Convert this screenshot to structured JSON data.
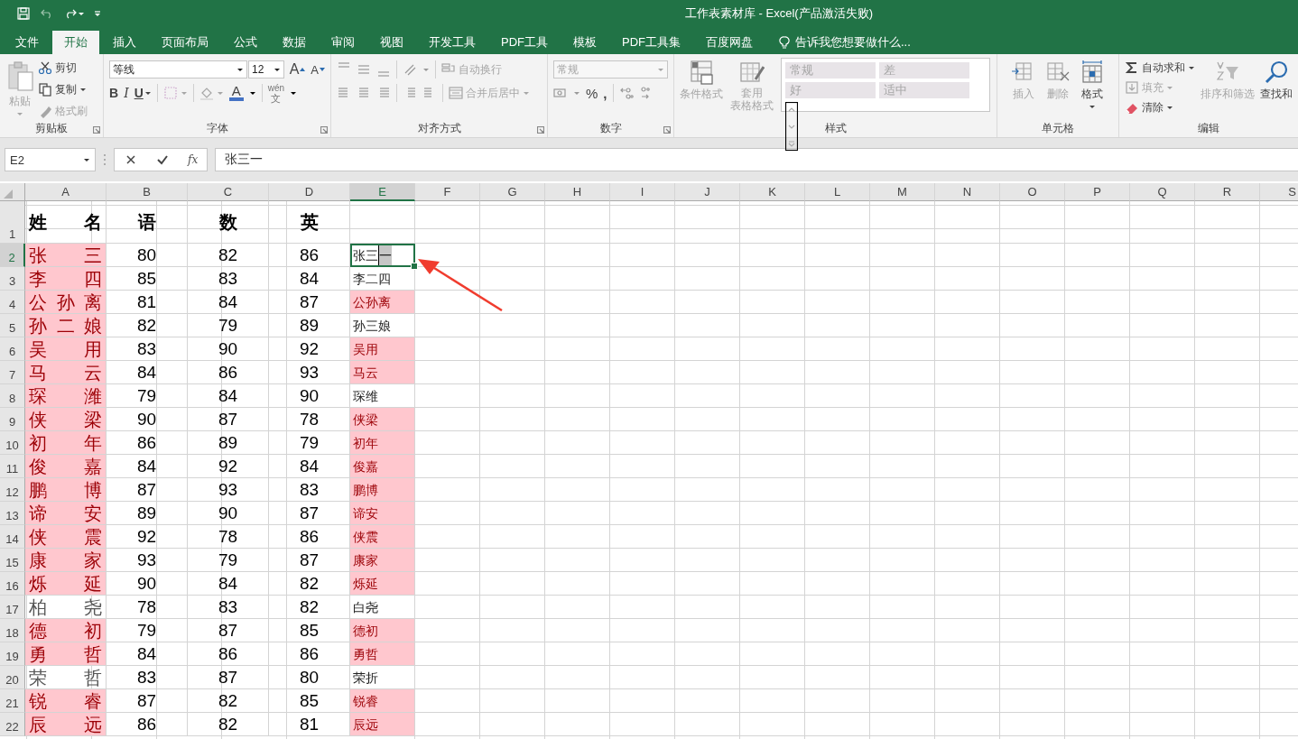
{
  "window": {
    "title": "工作表素材库 - Excel(产品激活失败)"
  },
  "tabs": [
    {
      "label": "文件",
      "selected": false
    },
    {
      "label": "开始",
      "selected": true
    },
    {
      "label": "插入",
      "selected": false
    },
    {
      "label": "页面布局",
      "selected": false
    },
    {
      "label": "公式",
      "selected": false
    },
    {
      "label": "数据",
      "selected": false
    },
    {
      "label": "审阅",
      "selected": false
    },
    {
      "label": "视图",
      "selected": false
    },
    {
      "label": "开发工具",
      "selected": false
    },
    {
      "label": "PDF工具",
      "selected": false
    },
    {
      "label": "模板",
      "selected": false
    },
    {
      "label": "PDF工具集",
      "selected": false
    },
    {
      "label": "百度网盘",
      "selected": false
    }
  ],
  "tell_me": {
    "placeholder": "告诉我您想要做什么..."
  },
  "ribbon": {
    "clipboard": {
      "label": "剪贴板",
      "paste": {
        "label": "粘贴",
        "disabled": true
      },
      "cut": {
        "label": "剪切",
        "disabled": false
      },
      "copy": {
        "label": "复制",
        "disabled": false
      },
      "format_painter": {
        "label": "格式刷",
        "disabled": true
      }
    },
    "font": {
      "label": "字体",
      "font_name": "等线",
      "font_size": "12",
      "grow": "A",
      "shrink": "A",
      "styles": [
        "B",
        "I",
        "U"
      ],
      "font_color": "A",
      "phonetic": [
        "wén",
        "文"
      ]
    },
    "alignment": {
      "label": "对齐方式",
      "wrap_text": {
        "label": "自动换行",
        "disabled": true
      },
      "merge": {
        "label": "合并后居中",
        "disabled": true
      }
    },
    "number": {
      "label": "数字",
      "format": "常规",
      "percent": "%",
      "comma": ","
    },
    "styles": {
      "label": "样式",
      "conditional": {
        "label": "条件格式",
        "disabled": true
      },
      "table_format": {
        "lines": [
          "套用",
          "表格格式"
        ],
        "disabled": true
      },
      "gallery": [
        "常规",
        "差",
        "好",
        "适中"
      ]
    },
    "cells": {
      "label": "单元格",
      "insert": {
        "label": "插入",
        "disabled": true
      },
      "delete": {
        "label": "删除",
        "disabled": true
      },
      "format": {
        "label": "格式",
        "disabled": false
      }
    },
    "editing": {
      "label": "编辑",
      "autosum": {
        "label": "自动求和",
        "disabled": false
      },
      "fill": {
        "label": "填充",
        "disabled": true
      },
      "clear": {
        "label": "清除",
        "disabled": false
      },
      "sort": {
        "label": "排序和筛选",
        "disabled": true
      },
      "find": {
        "label": "查找和",
        "disabled": false
      }
    }
  },
  "formula_bar": {
    "name_box": "E2",
    "function_label": "fx",
    "value": "张三一"
  },
  "sheet": {
    "columns": [
      {
        "label": "A",
        "selected": false
      },
      {
        "label": "B",
        "selected": false
      },
      {
        "label": "C",
        "selected": false
      },
      {
        "label": "D",
        "selected": false
      },
      {
        "label": "E",
        "selected": true
      },
      {
        "label": "F",
        "selected": false
      },
      {
        "label": "G",
        "selected": false
      },
      {
        "label": "H",
        "selected": false
      },
      {
        "label": "I",
        "selected": false
      },
      {
        "label": "J",
        "selected": false
      },
      {
        "label": "K",
        "selected": false
      },
      {
        "label": "L",
        "selected": false
      },
      {
        "label": "M",
        "selected": false
      },
      {
        "label": "N",
        "selected": false
      },
      {
        "label": "O",
        "selected": false
      },
      {
        "label": "P",
        "selected": false
      },
      {
        "label": "Q",
        "selected": false
      },
      {
        "label": "R",
        "selected": false
      },
      {
        "label": "S",
        "selected": false
      }
    ],
    "rows": [
      {
        "kind": "header",
        "number": "1",
        "selected": false,
        "name": "姓名",
        "highlighted": false,
        "scores": [
          "语",
          "数",
          "英"
        ]
      },
      {
        "kind": "data",
        "number": "2",
        "selected": true,
        "name": "张三",
        "highlighted": true,
        "scores": [
          "80",
          "82",
          "86"
        ],
        "e": {
          "text": "张三",
          "selection": "一",
          "highlighted": false,
          "editing": true
        }
      },
      {
        "kind": "data",
        "number": "3",
        "selected": false,
        "name": "李四",
        "highlighted": true,
        "scores": [
          "85",
          "83",
          "84"
        ],
        "e": {
          "text": "李二四",
          "highlighted": false,
          "editing": false
        }
      },
      {
        "kind": "data",
        "number": "4",
        "selected": false,
        "name": "公孙离",
        "highlighted": true,
        "scores": [
          "81",
          "84",
          "87"
        ],
        "e": {
          "text": "公孙离",
          "highlighted": true,
          "editing": false
        }
      },
      {
        "kind": "data",
        "number": "5",
        "selected": false,
        "name": "孙二娘",
        "highlighted": true,
        "scores": [
          "82",
          "79",
          "89"
        ],
        "e": {
          "text": "孙三娘",
          "highlighted": false,
          "editing": false
        }
      },
      {
        "kind": "data",
        "number": "6",
        "selected": false,
        "name": "吴用",
        "highlighted": true,
        "scores": [
          "83",
          "90",
          "92"
        ],
        "e": {
          "text": "吴用",
          "highlighted": true,
          "editing": false
        }
      },
      {
        "kind": "data",
        "number": "7",
        "selected": false,
        "name": "马云",
        "highlighted": true,
        "scores": [
          "84",
          "86",
          "93"
        ],
        "e": {
          "text": "马云",
          "highlighted": true,
          "editing": false
        }
      },
      {
        "kind": "data",
        "number": "8",
        "selected": false,
        "name": "琛潍",
        "highlighted": true,
        "scores": [
          "79",
          "84",
          "90"
        ],
        "e": {
          "text": "琛维",
          "highlighted": false,
          "editing": false
        }
      },
      {
        "kind": "data",
        "number": "9",
        "selected": false,
        "name": "侠梁",
        "highlighted": true,
        "scores": [
          "90",
          "87",
          "78"
        ],
        "e": {
          "text": "侠梁",
          "highlighted": true,
          "editing": false
        }
      },
      {
        "kind": "data",
        "number": "10",
        "selected": false,
        "name": "初年",
        "highlighted": true,
        "scores": [
          "86",
          "89",
          "79"
        ],
        "e": {
          "text": "初年",
          "highlighted": true,
          "editing": false
        }
      },
      {
        "kind": "data",
        "number": "11",
        "selected": false,
        "name": "俊嘉",
        "highlighted": true,
        "scores": [
          "84",
          "92",
          "84"
        ],
        "e": {
          "text": "俊嘉",
          "highlighted": true,
          "editing": false
        }
      },
      {
        "kind": "data",
        "number": "12",
        "selected": false,
        "name": "鹏博",
        "highlighted": true,
        "scores": [
          "87",
          "93",
          "83"
        ],
        "e": {
          "text": "鹏博",
          "highlighted": true,
          "editing": false
        }
      },
      {
        "kind": "data",
        "number": "13",
        "selected": false,
        "name": "谛安",
        "highlighted": true,
        "scores": [
          "89",
          "90",
          "87"
        ],
        "e": {
          "text": "谛安",
          "highlighted": true,
          "editing": false
        }
      },
      {
        "kind": "data",
        "number": "14",
        "selected": false,
        "name": "侠震",
        "highlighted": true,
        "scores": [
          "92",
          "78",
          "86"
        ],
        "e": {
          "text": "侠震",
          "highlighted": true,
          "editing": false
        }
      },
      {
        "kind": "data",
        "number": "15",
        "selected": false,
        "name": "康家",
        "highlighted": true,
        "scores": [
          "93",
          "79",
          "87"
        ],
        "e": {
          "text": "康家",
          "highlighted": true,
          "editing": false
        }
      },
      {
        "kind": "data",
        "number": "16",
        "selected": false,
        "name": "烁延",
        "highlighted": true,
        "scores": [
          "90",
          "84",
          "82"
        ],
        "e": {
          "text": "烁延",
          "highlighted": true,
          "editing": false
        }
      },
      {
        "kind": "data",
        "number": "17",
        "selected": false,
        "name": "柏尧",
        "highlighted": false,
        "scores": [
          "78",
          "83",
          "82"
        ],
        "e": {
          "text": "白尧",
          "highlighted": false,
          "editing": false
        }
      },
      {
        "kind": "data",
        "number": "18",
        "selected": false,
        "name": "德初",
        "highlighted": true,
        "scores": [
          "79",
          "87",
          "85"
        ],
        "e": {
          "text": "德初",
          "highlighted": true,
          "editing": false
        }
      },
      {
        "kind": "data",
        "number": "19",
        "selected": false,
        "name": "勇哲",
        "highlighted": true,
        "scores": [
          "84",
          "86",
          "86"
        ],
        "e": {
          "text": "勇哲",
          "highlighted": true,
          "editing": false
        }
      },
      {
        "kind": "data",
        "number": "20",
        "selected": false,
        "name": "荣哲",
        "highlighted": false,
        "scores": [
          "83",
          "87",
          "80"
        ],
        "e": {
          "text": "荣折",
          "highlighted": false,
          "editing": false
        }
      },
      {
        "kind": "data",
        "number": "21",
        "selected": false,
        "name": "锐睿",
        "highlighted": true,
        "scores": [
          "87",
          "82",
          "85"
        ],
        "e": {
          "text": "锐睿",
          "highlighted": true,
          "editing": false
        }
      },
      {
        "kind": "data",
        "number": "22",
        "selected": false,
        "name": "辰远",
        "highlighted": true,
        "scores": [
          "86",
          "82",
          "81"
        ],
        "e": {
          "text": "辰远",
          "highlighted": true,
          "editing": false
        }
      }
    ]
  }
}
